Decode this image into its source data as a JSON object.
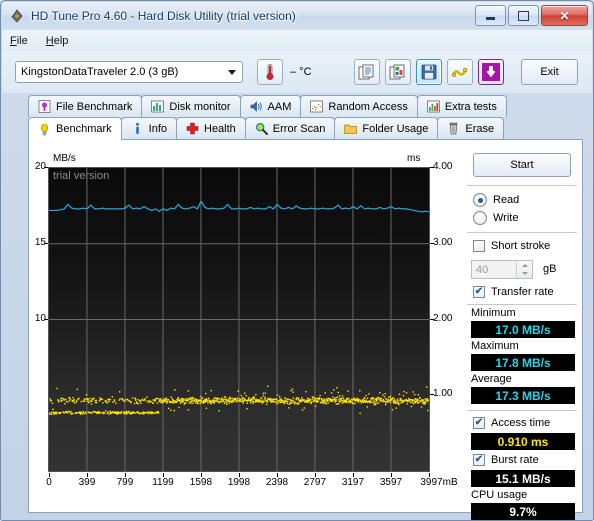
{
  "window": {
    "title": "HD Tune Pro 4.60 - Hard Disk Utility (trial version)",
    "minimize_label": "",
    "maximize_label": "",
    "close_label": "✕"
  },
  "menu": {
    "items": [
      {
        "label": "File",
        "accel": "F"
      },
      {
        "label": "Help",
        "accel": "H"
      }
    ]
  },
  "toolbar": {
    "drive_selected": "KingstonDataTraveler 2.0 (3 gB)",
    "temperature": "–  °C",
    "buttons": [
      {
        "name": "copy-text-icon",
        "label": ""
      },
      {
        "name": "copy-image-icon",
        "label": ""
      },
      {
        "name": "save-icon",
        "label": ""
      },
      {
        "name": "settings-icon",
        "label": ""
      },
      {
        "name": "download-icon",
        "label": ""
      }
    ],
    "exit_label": "Exit"
  },
  "tabs": {
    "top_row": [
      {
        "label": "File Benchmark",
        "icon": "file-benchmark-icon",
        "selected": false
      },
      {
        "label": "Disk monitor",
        "icon": "disk-monitor-icon",
        "selected": false
      },
      {
        "label": "AAM",
        "icon": "aam-speaker-icon",
        "selected": false
      },
      {
        "label": "Random Access",
        "icon": "random-access-icon",
        "selected": false
      },
      {
        "label": "Extra tests",
        "icon": "extra-tests-icon",
        "selected": false
      }
    ],
    "bottom_row": [
      {
        "label": "Benchmark",
        "icon": "benchmark-bulb-icon",
        "selected": true
      },
      {
        "label": "Info",
        "icon": "info-icon",
        "selected": false
      },
      {
        "label": "Health",
        "icon": "health-cross-icon",
        "selected": false
      },
      {
        "label": "Error Scan",
        "icon": "error-scan-magnifier-icon",
        "selected": false
      },
      {
        "label": "Folder Usage",
        "icon": "folder-usage-icon",
        "selected": false
      },
      {
        "label": "Erase",
        "icon": "erase-trash-icon",
        "selected": false
      }
    ]
  },
  "controls": {
    "start_label": "Start",
    "read_label": "Read",
    "write_label": "Write",
    "read_selected": true,
    "write_selected": false,
    "short_stroke_label": "Short stroke",
    "short_stroke_checked": false,
    "short_stroke_value": "40",
    "short_stroke_unit": "gB",
    "transfer_rate_label": "Transfer rate",
    "transfer_rate_checked": true,
    "access_time_label": "Access time",
    "access_time_checked": true,
    "burst_rate_label": "Burst rate",
    "burst_rate_checked": true
  },
  "results": {
    "minimum_label": "Minimum",
    "minimum_value": "17.0 MB/s",
    "maximum_label": "Maximum",
    "maximum_value": "17.8 MB/s",
    "average_label": "Average",
    "average_value": "17.3 MB/s",
    "access_time_value": "0.910 ms",
    "burst_rate_value": "15.1 MB/s",
    "cpu_usage_label": "CPU usage",
    "cpu_usage_value": "9.7%"
  },
  "chart_data": {
    "type": "line",
    "title": "",
    "watermark": "trial version",
    "xlabel": "",
    "ylabel": "MB/s",
    "y2label": "ms",
    "xlim": [
      0,
      3997
    ],
    "ylim": [
      0,
      20
    ],
    "y2lim": [
      0,
      4.0
    ],
    "grid": true,
    "xticks": [
      0,
      399,
      799,
      1199,
      1598,
      1998,
      2398,
      2797,
      3197,
      3597,
      3997
    ],
    "xticklabels": [
      "0",
      "399",
      "799",
      "1199",
      "1598",
      "1998",
      "2398",
      "2797",
      "3197",
      "3597",
      "3997mB"
    ],
    "yticks": [
      10,
      15,
      20
    ],
    "yticklabels": [
      "10",
      "15",
      "20"
    ],
    "y2ticks": [
      1.0,
      2.0,
      3.0,
      4.0
    ],
    "y2ticklabels": [
      "1.00",
      "2.00",
      "3.00",
      "4.00"
    ],
    "series": [
      {
        "name": "Transfer rate",
        "type": "line",
        "color": "#29a9e1",
        "axis": "left",
        "unit": "MB/s",
        "x": [
          0,
          40,
          80,
          120,
          160,
          200,
          240,
          280,
          320,
          360,
          400,
          440,
          480,
          520,
          560,
          600,
          640,
          680,
          720,
          760,
          800,
          840,
          880,
          920,
          960,
          1000,
          1040,
          1080,
          1120,
          1160,
          1200,
          1240,
          1280,
          1320,
          1360,
          1400,
          1440,
          1480,
          1520,
          1560,
          1600,
          1640,
          1680,
          1720,
          1760,
          1800,
          1840,
          1880,
          1920,
          1960,
          2000,
          2040,
          2080,
          2120,
          2160,
          2200,
          2240,
          2280,
          2320,
          2360,
          2400,
          2440,
          2480,
          2520,
          2560,
          2600,
          2640,
          2680,
          2720,
          2760,
          2800,
          2840,
          2880,
          2920,
          2960,
          3000,
          3040,
          3080,
          3120,
          3160,
          3200,
          3240,
          3280,
          3320,
          3360,
          3400,
          3440,
          3480,
          3520,
          3560,
          3600,
          3640,
          3680,
          3720,
          3760,
          3800,
          3840,
          3880,
          3920,
          3960,
          3997
        ],
        "values": [
          17.2,
          17.2,
          17.2,
          17.25,
          17.3,
          17.6,
          17.35,
          17.3,
          17.3,
          17.35,
          17.3,
          17.55,
          17.3,
          17.3,
          17.35,
          17.3,
          17.3,
          17.3,
          17.3,
          17.3,
          17.35,
          17.55,
          17.3,
          17.35,
          17.3,
          17.45,
          17.3,
          17.2,
          17.3,
          17.15,
          17.3,
          17.2,
          17.35,
          17.3,
          17.6,
          17.35,
          17.3,
          17.35,
          17.45,
          17.3,
          17.8,
          17.4,
          17.3,
          17.35,
          17.3,
          17.3,
          17.35,
          17.6,
          17.3,
          17.3,
          17.35,
          17.3,
          17.3,
          17.4,
          17.3,
          17.35,
          17.3,
          17.3,
          17.45,
          17.3,
          17.6,
          17.35,
          17.3,
          17.4,
          17.3,
          17.5,
          17.35,
          17.3,
          17.3,
          17.35,
          17.3,
          17.3,
          17.35,
          17.3,
          17.3,
          17.35,
          17.55,
          17.3,
          17.35,
          17.3,
          17.45,
          17.3,
          17.5,
          17.3,
          17.35,
          17.3,
          17.3,
          17.4,
          17.3,
          17.35,
          17.45,
          17.3,
          17.35,
          17.3,
          17.3,
          17.25,
          17.2,
          17.15,
          17.1,
          17.15,
          17.1
        ]
      },
      {
        "name": "Access time",
        "type": "scatter",
        "color": "#ffe400",
        "axis": "right",
        "unit": "ms",
        "average": 0.91,
        "cluster_main_ms": 0.94,
        "cluster_low_ms": 0.78,
        "cluster_low_extent_mb": 1150,
        "point_count": 1100
      }
    ]
  }
}
